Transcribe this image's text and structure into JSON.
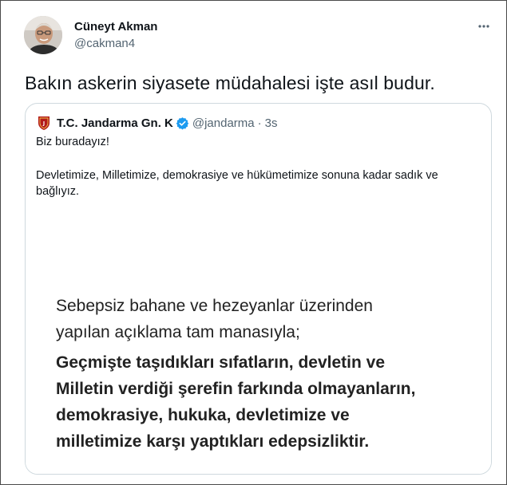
{
  "author": {
    "name": "Cüneyt Akman",
    "handle": "@cakman4"
  },
  "tweet": {
    "text": "Bakın askerin siyasete müdahalesi işte asıl budur."
  },
  "quoted": {
    "name": "T.C. Jandarma Gn. K",
    "handle": "@jandarma",
    "separator": "·",
    "time": "3s",
    "line1": "Biz buradayız!",
    "paragraph": "Devletimize, Milletimize, demokrasiye ve hükümetimize sonuna kadar sadık ve bağlıyız.",
    "image_lines": [
      "Sebepsiz bahane ve hezeyanlar üzerinden",
      "yapılan açıklama tam manasıyla;",
      "Geçmişte taşıdıkları sıfatların, devletin ve",
      "Milletin verdiği şerefin farkında olmayanların,",
      "demokrasiye, hukuka, devletimize ve",
      "milletimize karşı yaptıkları edepsizliktir."
    ]
  },
  "colors": {
    "text": "#0f1419",
    "secondary": "#536471",
    "verified": "#1d9bf0",
    "border": "#cfd9de",
    "emblem": "#b31b1b"
  },
  "icons": {
    "more": "more-horizontal-icon",
    "verified": "verified-badge-icon"
  }
}
